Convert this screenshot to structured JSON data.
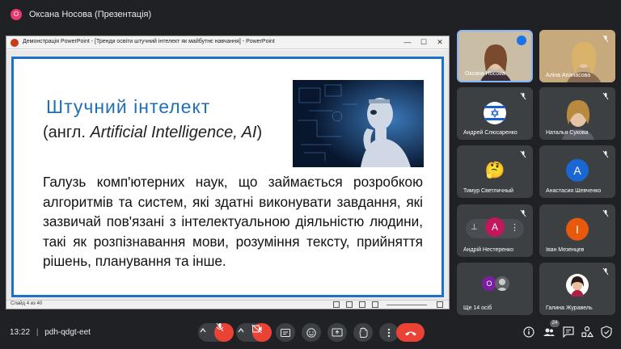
{
  "presenter": {
    "avatar_letter": "О",
    "title": "Оксана Носова (Презентація)"
  },
  "ppt": {
    "window_title": "Демонстрація PowerPoint - [Тренди освіти штучний інтелект як майбутнє навчання] - PowerPoint",
    "minimize": "—",
    "maximize": "☐",
    "close": "✕",
    "slide_title": "Штучний інтелект",
    "slide_subtitle_a": "(англ. ",
    "slide_subtitle_b": "Artificial Intelligence, AI",
    "slide_subtitle_c": ")",
    "slide_body": "Галузь комп'ютерних наук, що займається розробкою алгоритмів та систем, які здатні виконувати завдання, які зазвичай пов'язані з інтелектуальною діяльністю людини, такі як розпізнавання мови, розуміння тексту, прийняття рішень, планування та інше.",
    "slide_counter": "Слайд 4 из 40"
  },
  "participants": [
    {
      "name": "Оксана Носова",
      "type": "video"
    },
    {
      "name": "Аліна Апанасова",
      "type": "video"
    },
    {
      "name": "Андрей Слюсаренко",
      "type": "flag"
    },
    {
      "name": "Наталья Сукова",
      "type": "video"
    },
    {
      "name": "Тимур Светличный",
      "type": "emoji",
      "glyph": "🤔"
    },
    {
      "name": "Анастасия Шевченко",
      "type": "letter",
      "letter": "А"
    },
    {
      "name": "Андрій Нестеренко",
      "type": "letter",
      "letter": "А"
    },
    {
      "name": "Іван Мезенцев",
      "type": "letter",
      "letter": "І"
    },
    {
      "name": "Ще 14 осіб",
      "type": "more",
      "letter": "О"
    },
    {
      "name": "Галина Журавель",
      "type": "photo"
    }
  ],
  "bottom": {
    "time": "13:22",
    "separator": "|",
    "meeting_code": "pdh-qdgt-eet",
    "participant_count": "24"
  },
  "colors": {
    "accent_blue": "#1e72c6",
    "hangup": "#ea4335",
    "tile_bg": "#3c4043",
    "bg": "#202124"
  }
}
